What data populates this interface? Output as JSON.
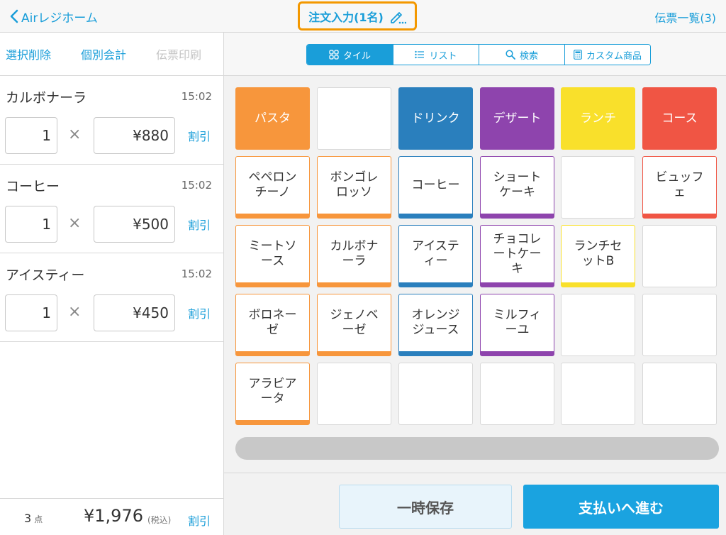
{
  "header": {
    "back_label": "Airレジホーム",
    "title": "注文入力(1名)",
    "order_list_link": "伝票一覧(3)"
  },
  "left_panel": {
    "actions": [
      "選択削除",
      "個別会計",
      "伝票印刷"
    ],
    "order_items": [
      {
        "name": "カルボナーラ",
        "time": "15:02",
        "qty": "1",
        "price": "¥880",
        "discount_label": "割引"
      },
      {
        "name": "コーヒー",
        "time": "15:02",
        "qty": "1",
        "price": "¥500",
        "discount_label": "割引"
      },
      {
        "name": "アイスティー",
        "time": "15:02",
        "qty": "1",
        "price": "¥450",
        "discount_label": "割引"
      }
    ],
    "times_symbol": "×",
    "footer": {
      "count": "3",
      "count_unit": "点",
      "total": "¥1,976",
      "tax_label": "(税込)",
      "discount_label": "割引"
    }
  },
  "view_tabs": [
    {
      "label": "タイル",
      "icon": "tile-grid-icon",
      "active": true
    },
    {
      "label": "リスト",
      "icon": "list-icon",
      "active": false
    },
    {
      "label": "検索",
      "icon": "search-icon",
      "active": false
    },
    {
      "label": "カスタム商品",
      "icon": "calculator-icon",
      "active": false
    }
  ],
  "colors": {
    "pasta": "#f7963c",
    "drink": "#2a7fbd",
    "dessert": "#8e44ad",
    "lunch": "#f9e02b",
    "course": "#f05544",
    "accent": "#1a9ed9",
    "highlight": "#f39800"
  },
  "tiles": [
    [
      {
        "type": "category",
        "label": "パスタ",
        "color": "#f7963c"
      },
      {
        "type": "empty"
      },
      {
        "type": "category",
        "label": "ドリンク",
        "color": "#2a7fbd"
      },
      {
        "type": "category",
        "label": "デザート",
        "color": "#8e44ad"
      },
      {
        "type": "category",
        "label": "ランチ",
        "color": "#f9e02b"
      },
      {
        "type": "category",
        "label": "コース",
        "color": "#f05544"
      }
    ],
    [
      {
        "type": "item",
        "label": "ペペロン\nチーノ",
        "color": "#f7963c"
      },
      {
        "type": "item",
        "label": "ボンゴレ\nロッソ",
        "color": "#f7963c"
      },
      {
        "type": "item",
        "label": "コーヒー",
        "color": "#2a7fbd"
      },
      {
        "type": "item",
        "label": "ショート\nケーキ",
        "color": "#8e44ad"
      },
      {
        "type": "empty"
      },
      {
        "type": "item",
        "label": "ビュッフ\nェ",
        "color": "#f05544"
      }
    ],
    [
      {
        "type": "item",
        "label": "ミートソ\nース",
        "color": "#f7963c"
      },
      {
        "type": "item",
        "label": "カルボナ\nーラ",
        "color": "#f7963c"
      },
      {
        "type": "item",
        "label": "アイステ\nィー",
        "color": "#2a7fbd"
      },
      {
        "type": "item",
        "label": "チョコレ\nートケー\nキ",
        "color": "#8e44ad"
      },
      {
        "type": "item",
        "label": "ランチセ\nットB",
        "color": "#f9e02b"
      },
      {
        "type": "empty"
      }
    ],
    [
      {
        "type": "item",
        "label": "ボロネー\nゼ",
        "color": "#f7963c"
      },
      {
        "type": "item",
        "label": "ジェノベ\nーゼ",
        "color": "#f7963c"
      },
      {
        "type": "item",
        "label": "オレンジ\nジュース",
        "color": "#2a7fbd"
      },
      {
        "type": "item",
        "label": "ミルフィ\nーユ",
        "color": "#8e44ad"
      },
      {
        "type": "empty"
      },
      {
        "type": "empty"
      }
    ],
    [
      {
        "type": "item",
        "label": "アラビア\nータ",
        "color": "#f7963c"
      },
      {
        "type": "empty"
      },
      {
        "type": "empty"
      },
      {
        "type": "empty"
      },
      {
        "type": "empty"
      },
      {
        "type": "empty"
      }
    ]
  ],
  "footer_buttons": {
    "hold": "一時保存",
    "pay": "支払いへ進む"
  }
}
